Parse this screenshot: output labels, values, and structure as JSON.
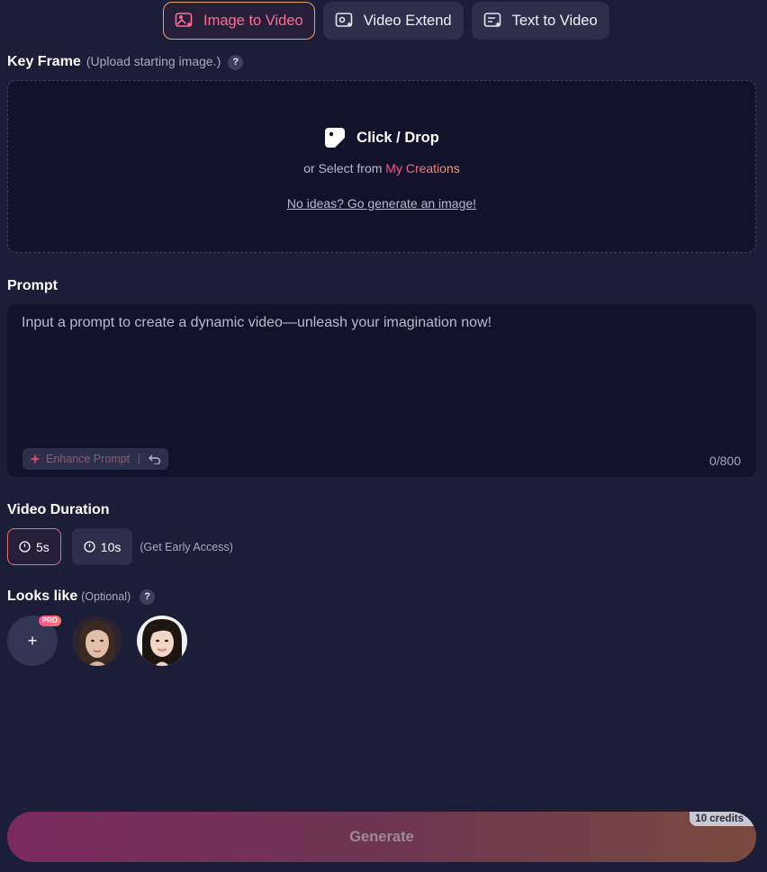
{
  "tabs": [
    {
      "label": "Image to Video",
      "active": true
    },
    {
      "label": "Video Extend",
      "active": false
    },
    {
      "label": "Text to Video",
      "active": false
    }
  ],
  "key_frame": {
    "title": "Key Frame",
    "hint": "(Upload starting image.)",
    "help": "?",
    "upload_title": "Click / Drop",
    "upload_sub_prefix": "or Select from",
    "upload_sub_link": "My Creations",
    "ideas_link": "No ideas? Go generate an image!"
  },
  "prompt": {
    "title": "Prompt",
    "placeholder": "Input a prompt to create a dynamic video—unleash your imagination now!",
    "enhance_label": "Enhance Prompt",
    "counter": "0/800"
  },
  "duration": {
    "title": "Video Duration",
    "options": [
      {
        "label": "5s",
        "active": true
      },
      {
        "label": "10s",
        "active": false
      }
    ],
    "note": "(Get Early Access)"
  },
  "looks_like": {
    "title": "Looks like",
    "hint": "(Optional)",
    "help": "?",
    "add_label": "+",
    "pro_badge": "PRO"
  },
  "generate": {
    "label": "Generate",
    "credits": "10 credits"
  },
  "colors": {
    "background": "#1c1d36",
    "panel": "#12122b",
    "accent_pink": "#ff4d8d",
    "accent_orange": "#ffa26b"
  }
}
